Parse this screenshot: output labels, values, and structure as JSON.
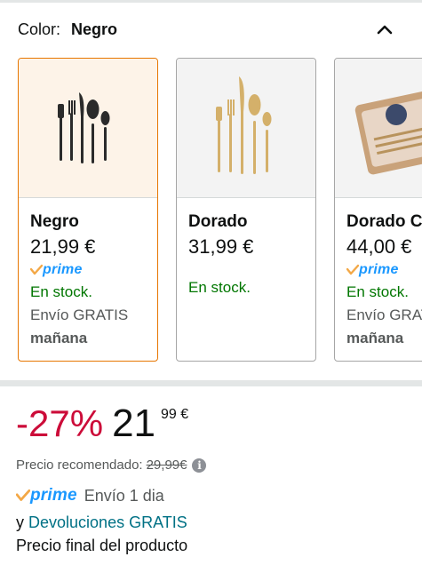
{
  "color_selector": {
    "label": "Color:",
    "selected_value": "Negro",
    "collapse_icon": "chevron-up-icon"
  },
  "variants": [
    {
      "name": "Negro",
      "price": "21,99 €",
      "prime": "prime",
      "stock": "En stock.",
      "shipping": "Envío GRATIS",
      "shipping_day": "mañana",
      "selected": true,
      "image_color": "#2b2b2b"
    },
    {
      "name": "Dorado",
      "price": "31,99 €",
      "prime": "",
      "stock": "En stock.",
      "shipping": "",
      "shipping_day": "",
      "selected": false,
      "image_color": "#d4b06a"
    },
    {
      "name": "Dorado C",
      "price": "44,00 €",
      "prime": "prime",
      "stock": "En stock.",
      "shipping": "Envío GRAT",
      "shipping_day": "mañana",
      "selected": false,
      "image_color": "#c9a27a"
    }
  ],
  "pricing": {
    "discount": "-27%",
    "price_whole": "21",
    "price_fraction": "99 €",
    "recommended_label": "Precio recomendado:",
    "recommended_price": "29,99€",
    "info_icon": "info-icon"
  },
  "delivery": {
    "prime_label": "prime",
    "delivery_text": "Envío 1 dia",
    "returns_prefix": "y",
    "returns_link": "Devoluciones GRATIS",
    "final_price_note": "Precio final del producto"
  },
  "colors": {
    "selected_border": "#e77600",
    "prime_blue": "#1a98ff",
    "prime_check": "#f3a847",
    "in_stock_green": "#007600",
    "discount_red": "#cc0c39",
    "link_teal": "#007185"
  }
}
